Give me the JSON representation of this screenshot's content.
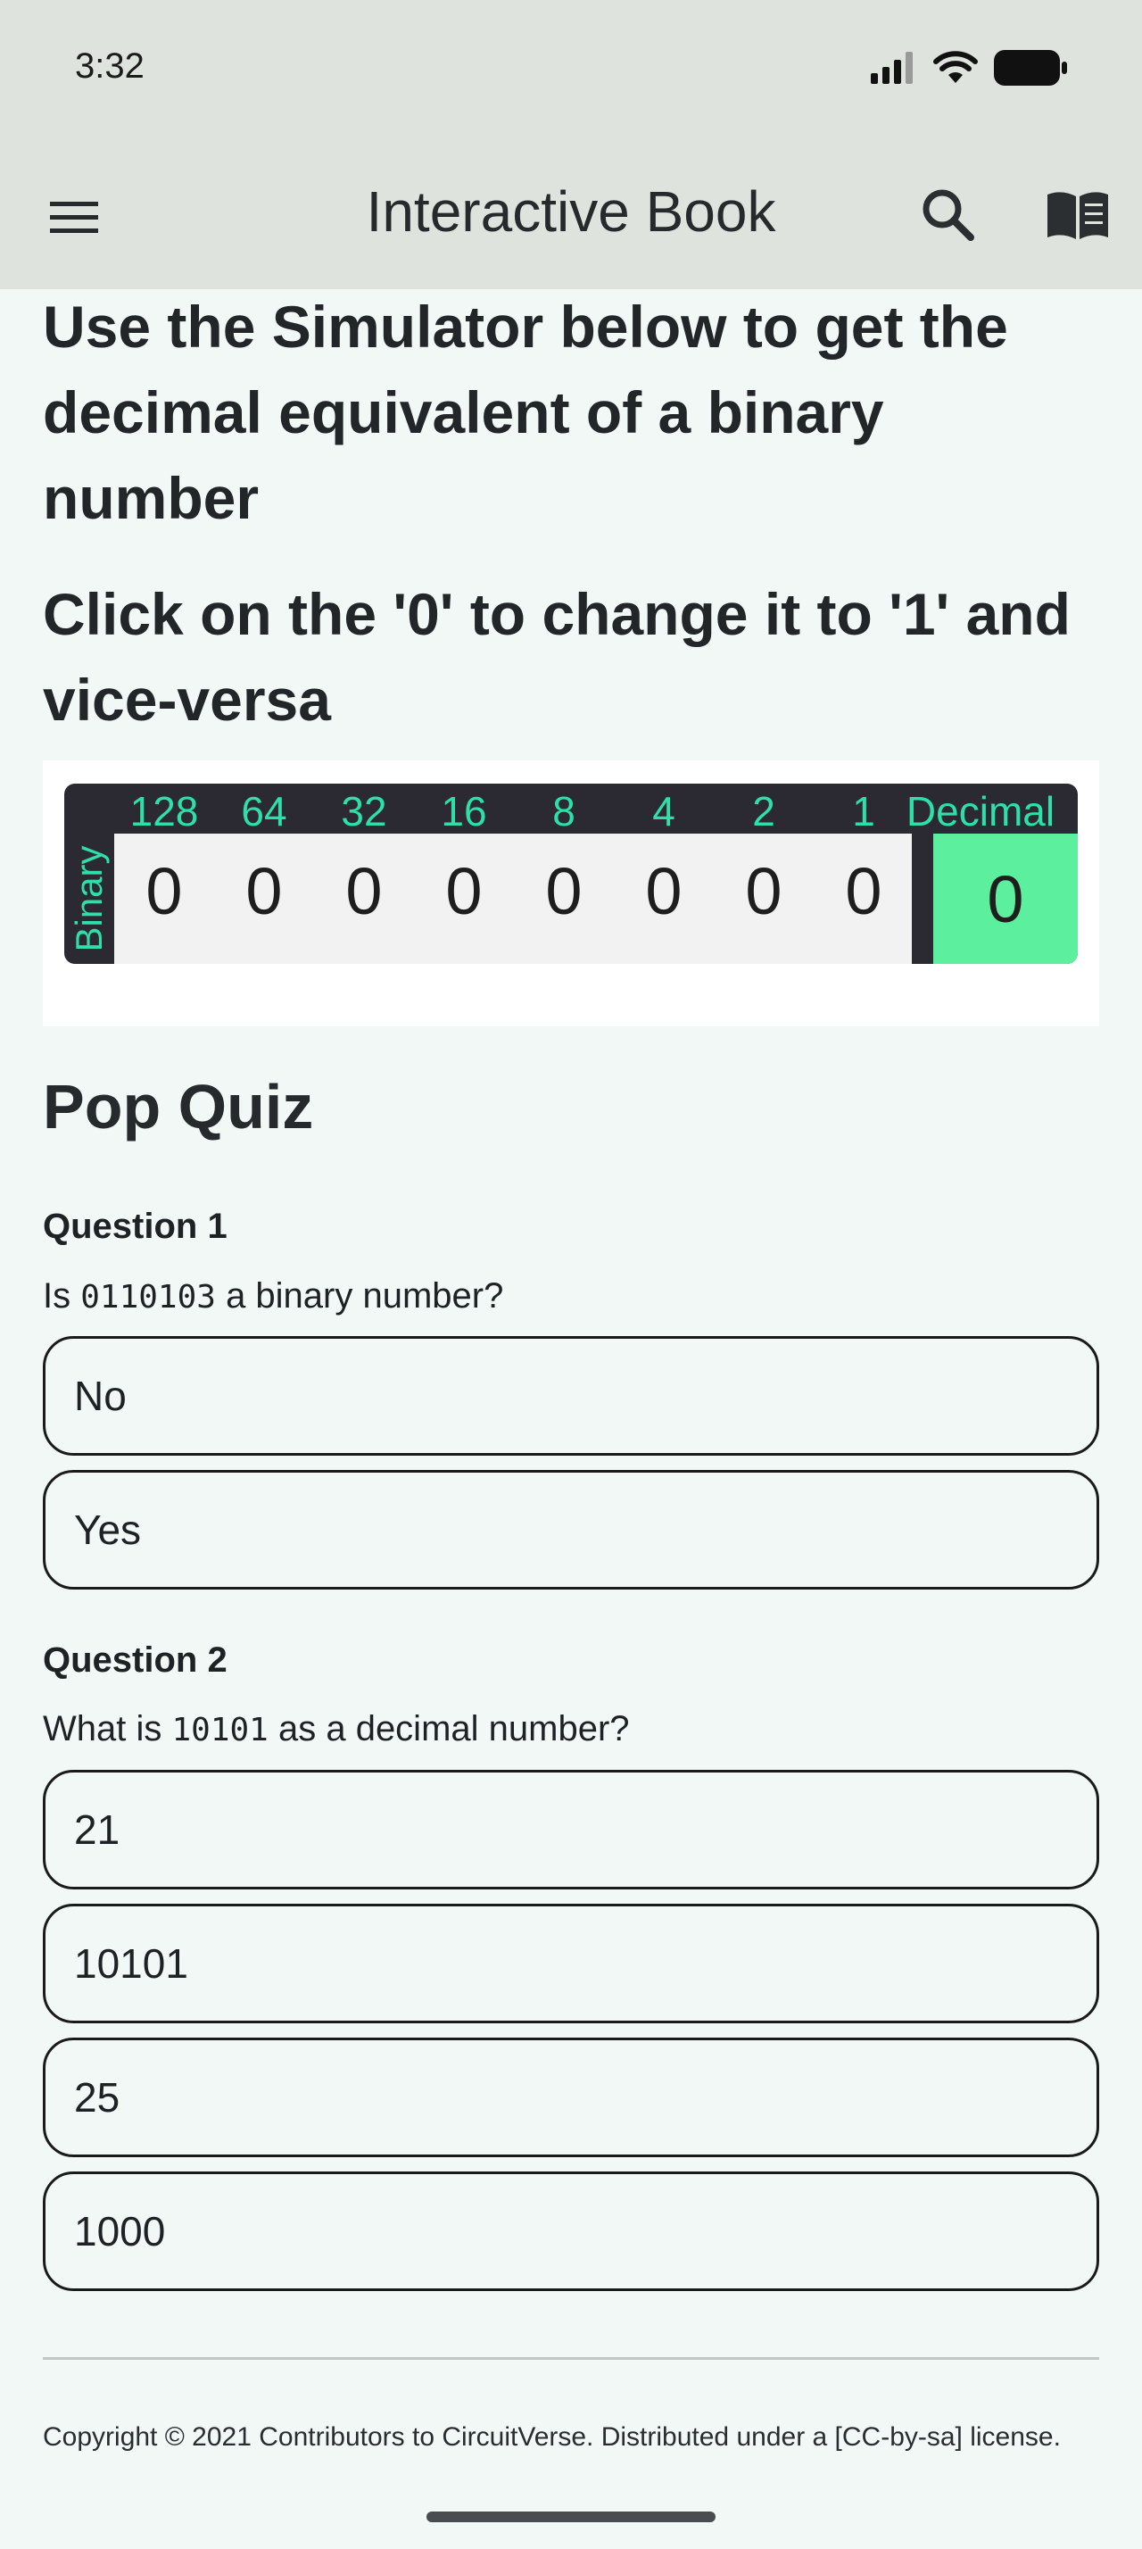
{
  "status_bar": {
    "time": "3:32"
  },
  "app_bar": {
    "title": "Interactive Book"
  },
  "intro": {
    "line1": "Use the Simulator below to get the decimal equivalent of a binary number",
    "line2": "Click on the '0' to change it to '1' and vice-versa"
  },
  "simulator": {
    "places": [
      "128",
      "64",
      "32",
      "16",
      "8",
      "4",
      "2",
      "1"
    ],
    "decimal_header": "Decimal",
    "row_label": "Binary",
    "bits": [
      "0",
      "0",
      "0",
      "0",
      "0",
      "0",
      "0",
      "0"
    ],
    "decimal_value": "0",
    "colors": {
      "accent": "#2ee0a8",
      "header_bg": "#2b2a33",
      "decimal_bg": "#5bef9e"
    }
  },
  "quiz": {
    "title": "Pop Quiz",
    "questions": [
      {
        "label": "Question 1",
        "text_pre": "Is ",
        "code": "0110103",
        "text_post": " a binary number?",
        "options": [
          "No",
          "Yes"
        ]
      },
      {
        "label": "Question 2",
        "text_pre": "What is ",
        "code": "10101",
        "text_post": " as a decimal number?",
        "options": [
          "21",
          "10101",
          "25",
          "1000"
        ]
      }
    ]
  },
  "footer": {
    "text": "Copyright © 2021 Contributors to CircuitVerse. Distributed under a [CC-by-sa] license."
  },
  "icons": [
    "menu-icon",
    "search-icon",
    "book-icon",
    "signal-icon",
    "wifi-icon",
    "battery-icon"
  ]
}
